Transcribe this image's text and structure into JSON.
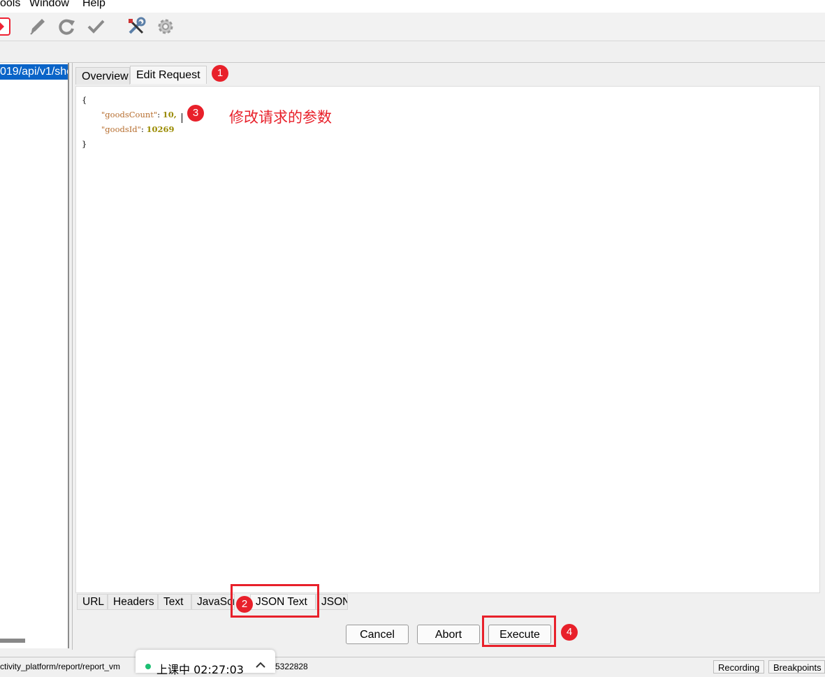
{
  "menu": {
    "tools": "ools",
    "window": "Window",
    "help": "Help"
  },
  "toolbar": {
    "icons": [
      "record-stop-icon",
      "pen-icon",
      "refresh-icon",
      "check-icon",
      "tools-icon",
      "settings-gear-icon"
    ]
  },
  "tree": {
    "selected_item": "019/api/v1/sho"
  },
  "top_tabs": {
    "overview": "Overview",
    "edit_request": "Edit Request"
  },
  "editor": {
    "open_brace": "{",
    "close_brace": "}",
    "lines": [
      {
        "key": "\"goodsCount\"",
        "colon": ": ",
        "value": "10,"
      },
      {
        "key": "\"goodsId\"",
        "colon": ": ",
        "value": "10269"
      }
    ]
  },
  "bottom_tabs": [
    "URL",
    "Headers",
    "Text",
    "JavaScri",
    "JSON Text",
    "JSON"
  ],
  "buttons": {
    "cancel": "Cancel",
    "abort": "Abort",
    "execute": "Execute"
  },
  "annotations": {
    "badge1": "1",
    "badge2": "2",
    "badge3": "3",
    "badge4": "4",
    "note": "修改请求的参数",
    "color": "#e8202a"
  },
  "status": {
    "path": "ctivity_platform/report/report_vm",
    "number": "5322828",
    "recording": "Recording",
    "breakpoints": "Breakpoints"
  },
  "live": {
    "text": "上课中 02:27:03",
    "dot_color": "#1dbf73"
  },
  "colors": {
    "selection": "#0a64c8",
    "json_key": "#b56b2b",
    "json_number": "#9a8b00"
  }
}
